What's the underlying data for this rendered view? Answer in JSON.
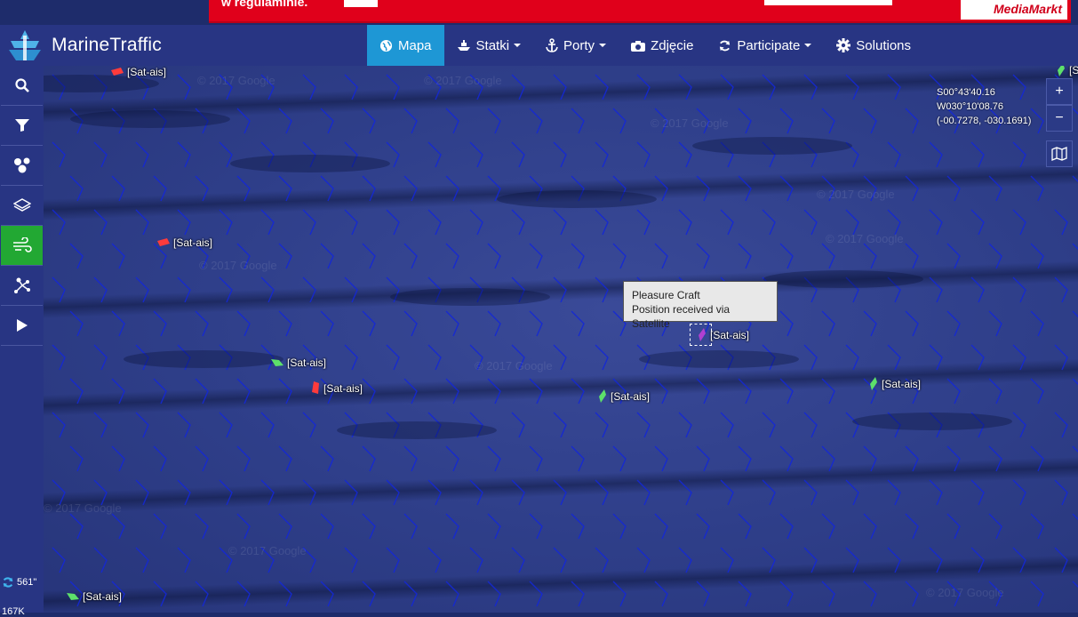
{
  "ad": {
    "text": "w regulaminie.",
    "brand": "MediaMarkt"
  },
  "header": {
    "logo_text": "MarineTraffic",
    "nav": [
      {
        "label": "Mapa",
        "icon": "globe-icon",
        "active": true
      },
      {
        "label": "Statki",
        "icon": "ship-icon",
        "dropdown": true
      },
      {
        "label": "Porty",
        "icon": "anchor-icon",
        "dropdown": true
      },
      {
        "label": "Zdjęcie",
        "icon": "camera-icon"
      },
      {
        "label": "Participate",
        "icon": "refresh-icon",
        "dropdown": true
      },
      {
        "label": "Solutions",
        "icon": "gear-icon"
      }
    ]
  },
  "sidebar": {
    "items": [
      {
        "icon": "search-icon"
      },
      {
        "icon": "filter-icon"
      },
      {
        "icon": "fleet-icon"
      },
      {
        "icon": "layers-icon"
      },
      {
        "icon": "wind-icon",
        "active": true
      },
      {
        "icon": "route-icon"
      },
      {
        "icon": "play-icon"
      }
    ],
    "refresh_count": "561\"",
    "vessel_count": "167K"
  },
  "map": {
    "coords": {
      "lat": "S00°43'40.16",
      "lon": "W030°10'08.76",
      "decimal": "(-00.7278, -030.1691)"
    },
    "zoom_in": "+",
    "zoom_out": "−",
    "watermark": "© 2017 Google",
    "tooltip": {
      "line1": "Pleasure Craft",
      "line2": "Position received via Satellite"
    },
    "vessels": [
      {
        "label": "[Sat-ais]",
        "color": "#ff3b3b"
      },
      {
        "label": "[Sat-ais]",
        "color": "#ff3b3b"
      },
      {
        "label": "[Sat-ais]",
        "color": "#5de06a"
      },
      {
        "label": "[Sat-ais]",
        "color": "#ff3b3b"
      },
      {
        "label": "[Sat-ais]",
        "color": "#5de06a"
      },
      {
        "label": "[Sat-ais]",
        "color": "#b040d0"
      },
      {
        "label": "[Sat-ais]",
        "color": "#5de06a"
      },
      {
        "label": "[Sat-ais]",
        "color": "#5de06a"
      },
      {
        "label": "[Sat",
        "color": "#5de06a"
      }
    ]
  }
}
